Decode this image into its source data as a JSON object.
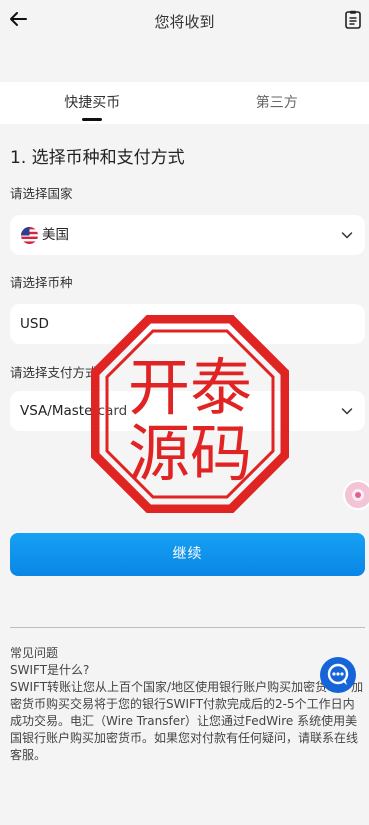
{
  "header": {
    "title": "您将收到"
  },
  "tabs": [
    {
      "label": "快捷买币",
      "active": true
    },
    {
      "label": "第三方",
      "active": false
    }
  ],
  "form": {
    "section_title": "1. 选择币种和支付方式",
    "country": {
      "label": "请选择国家",
      "value": "美国"
    },
    "currency": {
      "label": "请选择币种",
      "value": "USD"
    },
    "payment": {
      "label": "请选择支付方式",
      "value": "VSA/Mastercard"
    }
  },
  "continue_label": "继续",
  "faq": {
    "heading": "常见问题",
    "question": "SWIFT是什么?",
    "answer": "SWIFT转账让您从上百个国家/地区使用银行账户购买加密货币。加密货币购买交易将于您的银行SWIFT付款完成后的2-5个工作日内成功交易。电汇（Wire Transfer）让您通过FedWire 系统使用美国银行账户购买加密货币。如果您对付款有任何疑问，请联系在线客服。"
  },
  "stamp": {
    "line1": "开泰",
    "line2": "源码"
  },
  "colors": {
    "accent": "#0a86e6",
    "stamp": "#e02424",
    "background": "#f4f4f4",
    "chat_button": "#1565d8"
  },
  "icons": [
    "back-arrow-icon",
    "record-list-icon",
    "us-flag-icon",
    "chevron-down-icon",
    "chat-icon"
  ]
}
